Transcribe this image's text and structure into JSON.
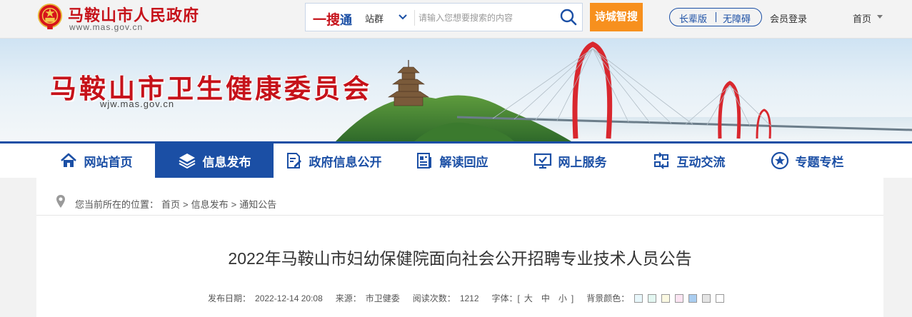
{
  "header": {
    "gov_name": "马鞍山市人民政府",
    "gov_url": "www.mas.gov.cn",
    "search": {
      "brand_main": "一搜",
      "brand_accent": "通",
      "scope": "站群",
      "placeholder": "请输入您想要搜索的内容"
    },
    "ai_button": "诗城智搜",
    "elder_mode": "长辈版",
    "accessible": "无障碍",
    "login": "会员登录",
    "home": "首页"
  },
  "banner": {
    "title": "马鞍山市卫生健康委员会",
    "url": "wjw.mas.gov.cn"
  },
  "nav": [
    {
      "label": "网站首页",
      "icon": "home-icon"
    },
    {
      "label": "信息发布",
      "icon": "layers-icon"
    },
    {
      "label": "政府信息公开",
      "icon": "document-edit-icon"
    },
    {
      "label": "解读回应",
      "icon": "newspaper-icon"
    },
    {
      "label": "网上服务",
      "icon": "monitor-check-icon"
    },
    {
      "label": "互动交流",
      "icon": "exchange-icon"
    },
    {
      "label": "专题专栏",
      "icon": "star-circle-icon"
    }
  ],
  "breadcrumb": {
    "prefix": "您当前所在的位置：",
    "items": [
      "首页",
      "信息发布",
      "通知公告"
    ],
    "sep": ">"
  },
  "article": {
    "title": "2022年马鞍山市妇幼保健院面向社会公开招聘专业技术人员公告",
    "date_label": "发布日期：",
    "date": "2022-12-14 20:08",
    "source_label": "来源：",
    "source": "市卫健委",
    "views_label": "阅读次数：",
    "views": "1212",
    "font_label": "字体：[",
    "font_large": "大",
    "font_mid": "中",
    "font_small": "小",
    "font_end": "]",
    "bg_label": "背景颜色："
  },
  "colors": {
    "brand_red": "#c6121a",
    "brand_blue": "#1b4fa5",
    "ai_orange": "#f7901e",
    "bg_swatches": [
      "#e8f7fb",
      "#e3f7f1",
      "#fbf9e2",
      "#fce4f2",
      "#a9cdf0",
      "#e4e4e4",
      "#ffffff"
    ]
  }
}
